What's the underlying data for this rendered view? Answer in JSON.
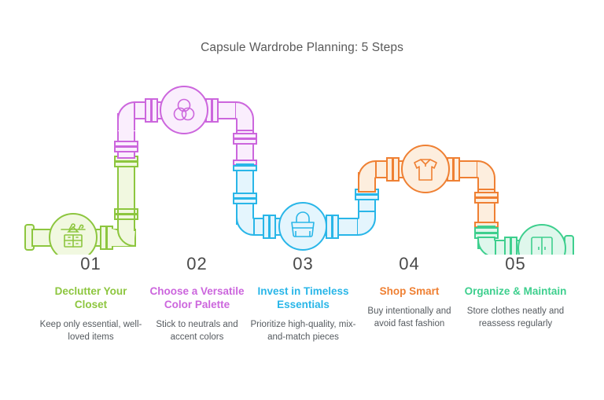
{
  "header": {
    "title": "Capsule Wardrobe Planning: 5 Steps"
  },
  "diagram": {
    "type": "pipeline-infographic",
    "orientation": "horizontal-zigzag",
    "background": "#ffffff",
    "left_end_cap": "pipe-end-cap",
    "right_end_cap": "pipe-end-cap"
  },
  "steps": [
    {
      "number": "01",
      "title": "Declutter Your Closet",
      "description": "Keep only essential, well-loved items",
      "color": "#8dc63f",
      "fill": "#f1f8e0",
      "icon": "closet-shelf-hangers-icon",
      "level": "low"
    },
    {
      "number": "02",
      "title": "Choose a Versatile Color Palette",
      "description": "Stick to neutrals and accent colors",
      "color": "#cc66dd",
      "fill": "#faeefd",
      "icon": "color-palette-venn-icon",
      "level": "high"
    },
    {
      "number": "03",
      "title": "Invest in Timeless Essentials",
      "description": "Prioritize high-quality, mix-and-match pieces",
      "color": "#29b6e8",
      "fill": "#e4f5fd",
      "icon": "handbag-icon",
      "level": "mid"
    },
    {
      "number": "04",
      "title": "Shop Smart",
      "description": "Buy intentionally and avoid fast fashion",
      "color": "#ef8033",
      "fill": "#fdeede",
      "icon": "tshirt-icon",
      "level": "upper"
    },
    {
      "number": "05",
      "title": "Organize & Maintain",
      "description": "Store clothes neatly and reassess regularly",
      "color": "#3ecf8e",
      "fill": "#dff7ec",
      "icon": "wardrobe-doors-icon",
      "level": "low"
    }
  ]
}
